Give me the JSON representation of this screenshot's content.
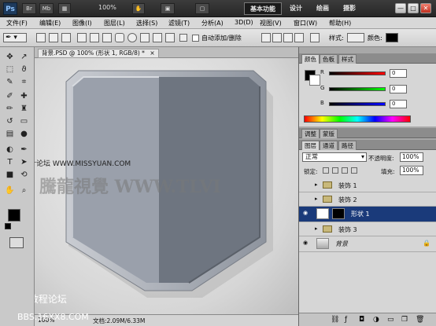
{
  "app": {
    "logo": "Ps",
    "title_buttons": [
      "Br",
      "Mb"
    ],
    "zoom": "100%",
    "workspace_buttons": [
      "基本功能",
      "设计",
      "绘画",
      "摄影"
    ],
    "window_controls": [
      "—",
      "□",
      "✕"
    ]
  },
  "menu": [
    "文件(F)",
    "编辑(E)",
    "图像(I)",
    "图层(L)",
    "选择(S)",
    "滤镜(T)",
    "分析(A)",
    "3D(D)",
    "视图(V)",
    "窗口(W)",
    "帮助(H)"
  ],
  "options": {
    "auto_add_delete": "自动添加/删除",
    "style_label": "样式:",
    "color_label": "颜色:"
  },
  "document": {
    "tab_title": "背景.PSD @ 100% (形状 1, RGB/8) *",
    "zoom_status": "100%",
    "doc_status": "文档:2.09M/6.33M"
  },
  "watermarks": {
    "site_overlay": "思缘设计论坛 WWW.MISSYUAN.COM",
    "cn_logo": "騰龍視覺 WWW.TLVI",
    "bottom_line1": "PS教程论坛",
    "bottom_line2": "BBS.16XX8.COM"
  },
  "color_panel": {
    "tabs": [
      "颜色",
      "色板",
      "样式"
    ],
    "R": {
      "label": "R",
      "value": "0"
    },
    "G": {
      "label": "G",
      "value": "0"
    },
    "B": {
      "label": "B",
      "value": "0"
    }
  },
  "adjust_panel": {
    "tabs": [
      "调整",
      "蒙版"
    ]
  },
  "layers_panel": {
    "tabs": [
      "图层",
      "通道",
      "路径"
    ],
    "blend_mode": "正常",
    "opacity_label": "不透明度:",
    "opacity": "100%",
    "lock_label": "锁定:",
    "fill_label": "填充:",
    "fill": "100%",
    "layers": [
      {
        "name": "装饰 1",
        "type": "group",
        "visible": false,
        "selected": false
      },
      {
        "name": "装饰 2",
        "type": "group",
        "visible": false,
        "selected": false
      },
      {
        "name": "形状 1",
        "type": "shape",
        "visible": true,
        "selected": true
      },
      {
        "name": "装饰 3",
        "type": "group",
        "visible": false,
        "selected": false
      },
      {
        "name": "背景",
        "type": "background",
        "visible": true,
        "selected": false
      }
    ]
  },
  "colors": {
    "selected_layer": "#1a3a7a",
    "shield_light": "#9aa0ab",
    "shield_dark": "#6e7580"
  }
}
